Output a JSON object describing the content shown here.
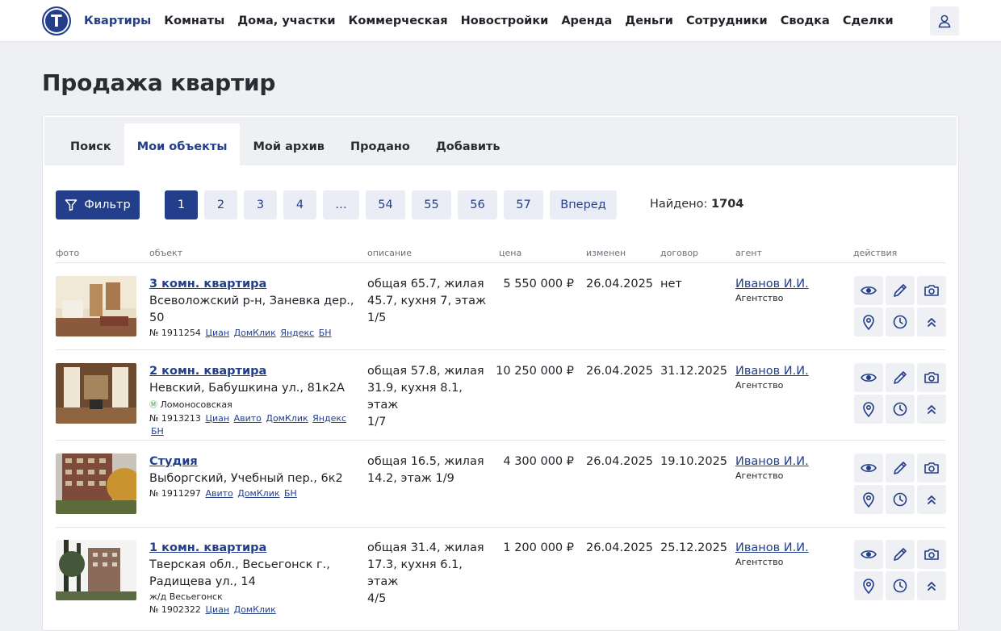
{
  "app": {
    "logo_letter": "Т",
    "nav": [
      "Квартиры",
      "Комнаты",
      "Дома, участки",
      "Коммерческая",
      "Новостройки",
      "Аренда",
      "Деньги",
      "Сотрудники",
      "Сводка",
      "Сделки"
    ],
    "active_nav": "Квартиры"
  },
  "page": {
    "title": "Продажа квартир"
  },
  "tabs": [
    "Поиск",
    "Мои объекты",
    "Мой архив",
    "Продано",
    "Добавить"
  ],
  "active_tab": "Мои объекты",
  "toolbar": {
    "filter_label": "Фильтр",
    "pages": [
      "1",
      "2",
      "3",
      "4",
      "…",
      "54",
      "55",
      "56",
      "57"
    ],
    "current_page": "1",
    "next_label": "Вперед",
    "found_label": "Найдено:",
    "found_count": "1704"
  },
  "columns": {
    "photo": "фото",
    "object": "объект",
    "description": "описание",
    "price": "цена",
    "changed": "изменен",
    "contract": "договор",
    "agent": "агент",
    "actions": "действия"
  },
  "listings": [
    {
      "title": "3 комн. квартира",
      "address_lines": [
        "Всеволожский р-н, Заневка дер., 50"
      ],
      "metro": "",
      "number": "№ 1911254",
      "sources": [
        "Циан",
        "ДомКлик",
        "Яндекс",
        "БН"
      ],
      "description_lines": [
        "общая 65.7, жилая",
        "45.7, кухня 7, этаж",
        "1/5"
      ],
      "price": "5 550 000 ₽",
      "changed": "26.04.2025",
      "contract": "нет",
      "agent": "Иванов И.И.",
      "agency": "Агентство"
    },
    {
      "title": "2 комн. квартира",
      "address_lines": [
        "Невский, Бабушкина ул., 81к2А"
      ],
      "metro": "Ломоносовская",
      "number": "№ 1913213",
      "sources": [
        "Циан",
        "Авито",
        "ДомКлик",
        "Яндекс",
        "БН"
      ],
      "description_lines": [
        "общая 57.8, жилая",
        "31.9, кухня 8.1, этаж",
        "1/7"
      ],
      "price": "10 250 000 ₽",
      "changed": "26.04.2025",
      "contract": "31.12.2025",
      "agent": "Иванов И.И.",
      "agency": "Агентство"
    },
    {
      "title": "Студия",
      "address_lines": [
        "Выборгский, Учебный пер., 6к2"
      ],
      "metro": "",
      "number": "№ 1911297",
      "sources": [
        "Авито",
        "ДомКлик",
        "БН"
      ],
      "description_lines": [
        "общая 16.5, жилая",
        "14.2, этаж 1/9"
      ],
      "price": "4 300 000 ₽",
      "changed": "26.04.2025",
      "contract": "19.10.2025",
      "agent": "Иванов И.И.",
      "agency": "Агентство"
    },
    {
      "title": "1 комн. квартира",
      "address_lines": [
        "Тверская обл., Весьегонск г.,",
        "Радищева ул., 14"
      ],
      "station": "ж/д Весьегонск",
      "metro": "",
      "number": "№ 1902322",
      "sources": [
        "Циан",
        "ДомКлик"
      ],
      "description_lines": [
        "общая 31.4, жилая",
        "17.3, кухня 6.1, этаж",
        "4/5"
      ],
      "price": "1 200 000 ₽",
      "changed": "26.04.2025",
      "contract": "25.12.2025",
      "agent": "Иванов И.И.",
      "agency": "Агентство"
    }
  ],
  "row_actions": [
    "eye-icon",
    "pencil-icon",
    "camera-icon",
    "map-pin-icon",
    "clock-icon",
    "double-chevron-up-icon"
  ],
  "colors": {
    "brand": "#233f8c",
    "background": "#eef0f3",
    "metro_green": "#3a9a4a"
  }
}
